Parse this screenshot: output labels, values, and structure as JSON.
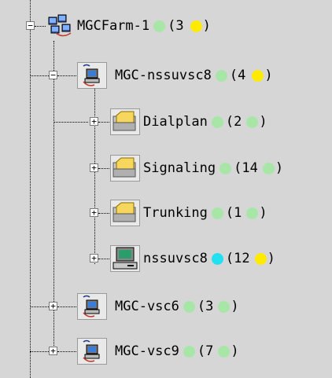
{
  "colors": {
    "green": "#a8e6a8",
    "yellow": "#ffea00",
    "cyan": "#22e0f0"
  },
  "tree": {
    "root": {
      "label": "MGCFarm-1",
      "status_color": "green",
      "count_open": "(3",
      "count_status_color": "yellow",
      "count_close": ")",
      "icon": "server-farm-icon",
      "expander": "−"
    },
    "host": {
      "label": "MGC-nssuvsc8",
      "status_color": "green",
      "count_open": "(4",
      "count_status_color": "yellow",
      "count_close": ")",
      "icon": "network-host-icon",
      "expander": "−"
    },
    "children": [
      {
        "label": "Dialplan",
        "status_color": "green",
        "count_open": "(2",
        "count_status_color": "green",
        "count_close": ")",
        "icon": "folder-icon",
        "expander": "+"
      },
      {
        "label": "Signaling",
        "status_color": "green",
        "count_open": "(14",
        "count_status_color": "green",
        "count_close": ")",
        "icon": "folder-icon",
        "expander": "+"
      },
      {
        "label": "Trunking",
        "status_color": "green",
        "count_open": "(1",
        "count_status_color": "green",
        "count_close": ")",
        "icon": "folder-icon",
        "expander": "+"
      },
      {
        "label": "nssuvsc8",
        "status_color": "cyan",
        "count_open": "(12",
        "count_status_color": "yellow",
        "count_close": ")",
        "icon": "computer-icon",
        "expander": "+"
      }
    ],
    "siblings": [
      {
        "label": "MGC-vsc6",
        "status_color": "green",
        "count_open": "(3",
        "count_status_color": "green",
        "count_close": ")",
        "icon": "network-host-icon",
        "expander": "+"
      },
      {
        "label": "MGC-vsc9",
        "status_color": "green",
        "count_open": "(7",
        "count_status_color": "green",
        "count_close": ")",
        "icon": "network-host-icon",
        "expander": "+"
      }
    ]
  }
}
